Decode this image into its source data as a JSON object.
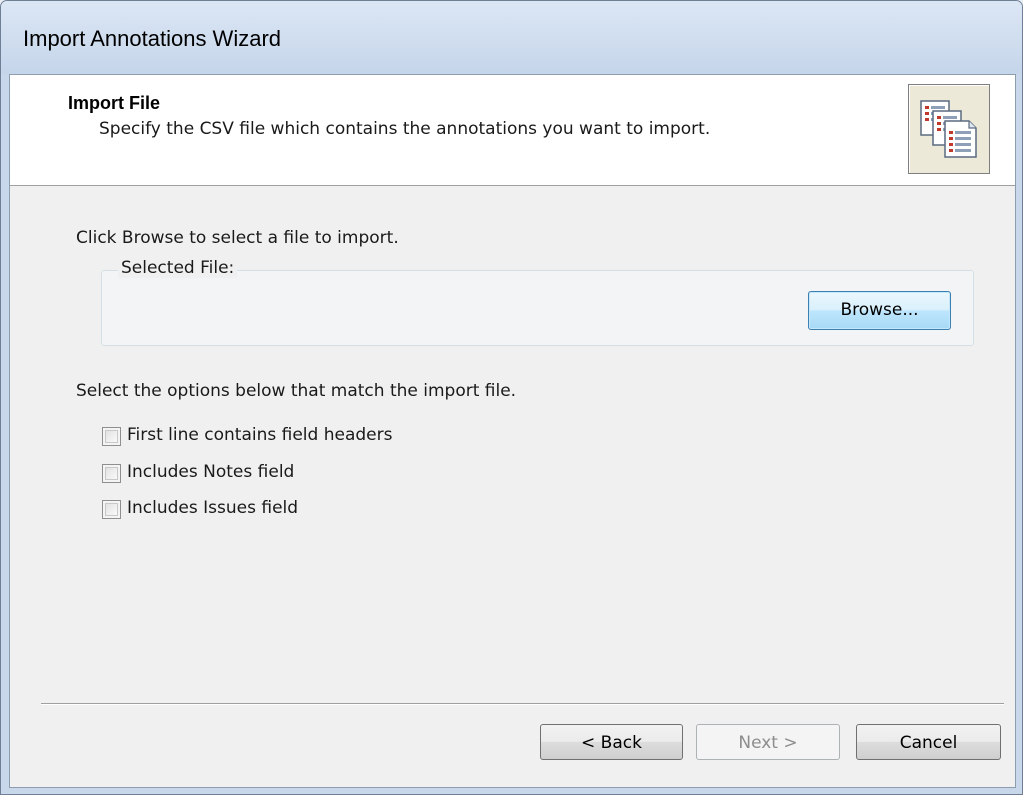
{
  "window": {
    "title": "Import Annotations Wizard"
  },
  "header": {
    "title": "Import File",
    "description": "Specify the CSV file which contains the annotations you want to import.",
    "icon": "multiple-documents-icon"
  },
  "file_section": {
    "instruction": "Click Browse to select a file to import.",
    "group_label": "Selected File:",
    "browse_label": "Browse..."
  },
  "options_section": {
    "instruction": "Select the options below that match the import file.",
    "options": [
      {
        "label": "First line contains field headers",
        "checked": false
      },
      {
        "label": "Includes Notes field",
        "checked": false
      },
      {
        "label": "Includes Issues field",
        "checked": false
      }
    ]
  },
  "footer": {
    "back_label": "< Back",
    "next_label": "Next >",
    "cancel_label": "Cancel",
    "next_enabled": false
  },
  "colors": {
    "title_bar": "#c9d7ea",
    "focused_button_border": "#3c7fb1",
    "disabled_text": "#8d8d8d"
  }
}
